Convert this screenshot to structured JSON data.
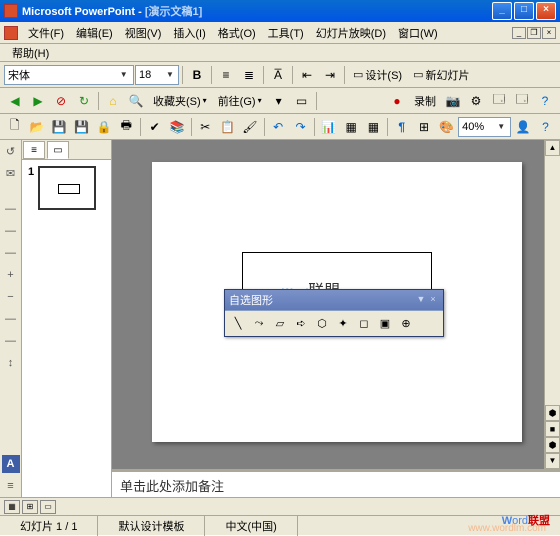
{
  "title": {
    "app": "Microsoft PowerPoint",
    "sep": " - ",
    "doc": "[演示文稿1]"
  },
  "menu": {
    "file": "文件(F)",
    "edit": "编辑(E)",
    "view": "视图(V)",
    "insert": "插入(I)",
    "format": "格式(O)",
    "tools": "工具(T)",
    "slideshow": "幻灯片放映(D)",
    "window": "窗口(W)",
    "help": "帮助(H)"
  },
  "format_tb": {
    "font": "宋体",
    "size": "18",
    "bold": "B",
    "design": "设计(S)",
    "newslide": "新幻灯片"
  },
  "web_tb": {
    "fav": "收藏夹(S)",
    "go": "前往(G)"
  },
  "rec_tb": {
    "rec": "录制"
  },
  "std_tb": {
    "zoom": "40%"
  },
  "thumb": {
    "num": "1"
  },
  "autoshape": {
    "title": "自选图形"
  },
  "notes": {
    "placeholder": "单击此处添加备注"
  },
  "status": {
    "slide": "幻灯片 1 / 1",
    "template": "默认设计模板",
    "lang": "中文(中国)"
  },
  "watermark": {
    "w": "W",
    "ord": "ord",
    "lm": "联盟",
    "url": "www.wordlm.com"
  }
}
